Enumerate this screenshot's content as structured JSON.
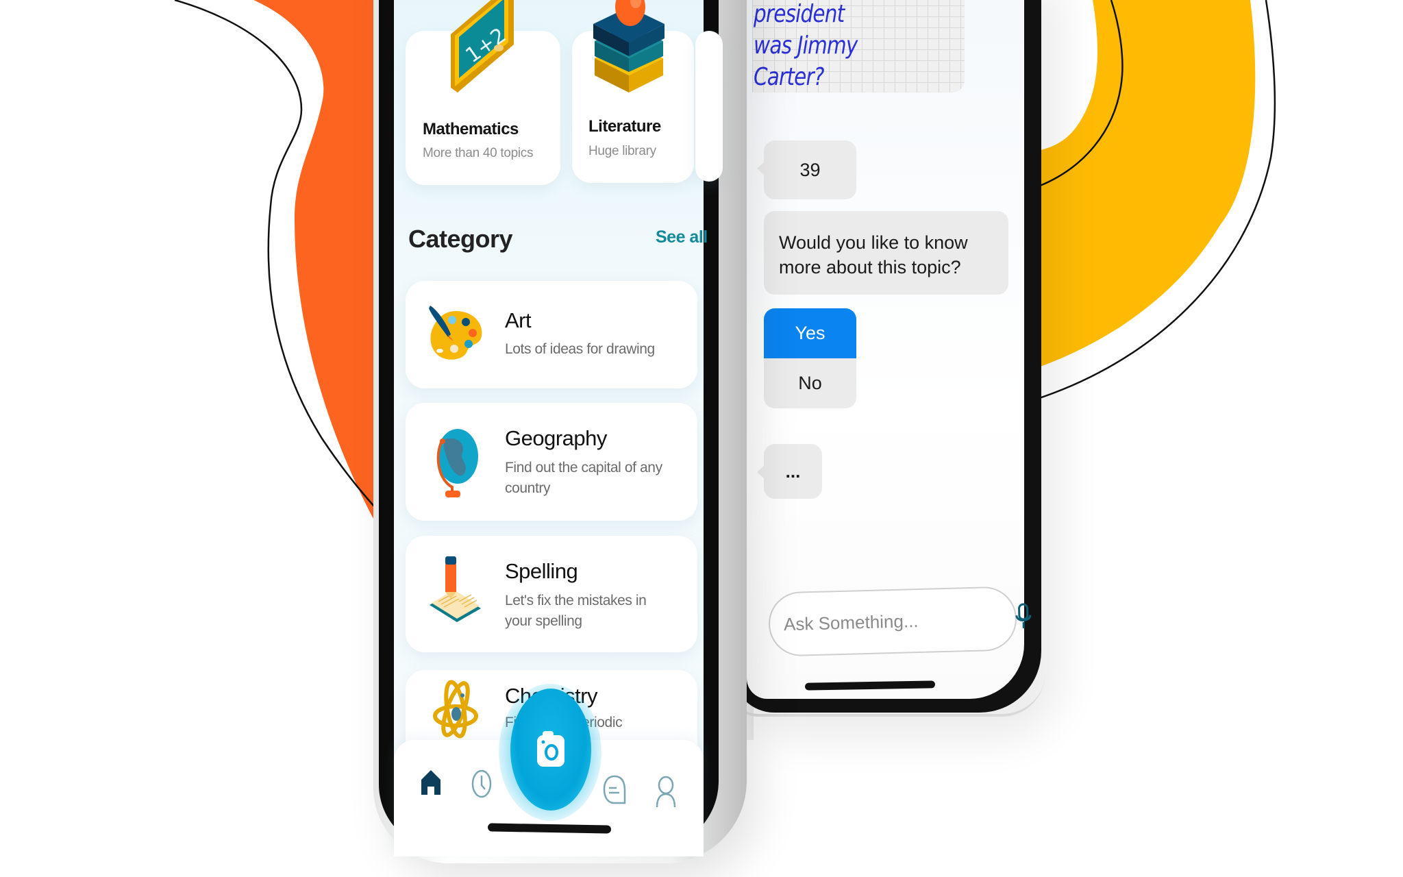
{
  "colors": {
    "orange_blob": "#fd6420",
    "yellow_blob": "#ffbb04",
    "accent_teal": "#13899a",
    "primary_blue": "#0a84f0",
    "camera_cyan": "#02a6da",
    "nav_active": "#0d3f5a",
    "nav_inactive": "#7aa6b3",
    "handwriting_blue": "#2a2fd6"
  },
  "home_screen": {
    "featured_cards": [
      {
        "title": "Mathematics",
        "subtitle": "More than 40 topics",
        "icon": "chalkboard-icon"
      },
      {
        "title": "Literature",
        "subtitle": "Huge library",
        "icon": "books-stack-icon"
      }
    ],
    "category_section": {
      "heading": "Category",
      "see_all_label": "See all"
    },
    "categories": [
      {
        "title": "Art",
        "subtitle": "Lots of ideas for drawing",
        "icon": "paint-palette-icon"
      },
      {
        "title": "Geography",
        "subtitle": "Find out the capital of any country",
        "icon": "globe-icon"
      },
      {
        "title": "Spelling",
        "subtitle": "Let's fix the mistakes in your spelling",
        "icon": "pencil-book-icon"
      },
      {
        "title": "Chemistry",
        "subtitle_visible_left": "Fi",
        "subtitle_visible_right": "eriodic",
        "icon": "atom-icon"
      }
    ],
    "bottom_nav": [
      {
        "name": "home",
        "icon": "home-icon",
        "active": true
      },
      {
        "name": "history",
        "icon": "clock-icon",
        "active": false
      },
      {
        "name": "camera",
        "icon": "camera-icon",
        "active": false
      },
      {
        "name": "chat",
        "icon": "chat-bubble-icon",
        "active": false
      },
      {
        "name": "profile",
        "icon": "user-icon",
        "active": false
      }
    ]
  },
  "chat_screen": {
    "scanned_question_lines": [
      "What number president",
      "was Jimmy Carter?"
    ],
    "messages": [
      {
        "from": "bot",
        "text": "39"
      },
      {
        "from": "bot",
        "text": "Would you like to know more about this topic?"
      }
    ],
    "choices": [
      {
        "label": "Yes",
        "selected": true
      },
      {
        "label": "No",
        "selected": false
      }
    ],
    "typing_indicator": "...",
    "input": {
      "value": "",
      "placeholder": "Ask Something..."
    }
  }
}
